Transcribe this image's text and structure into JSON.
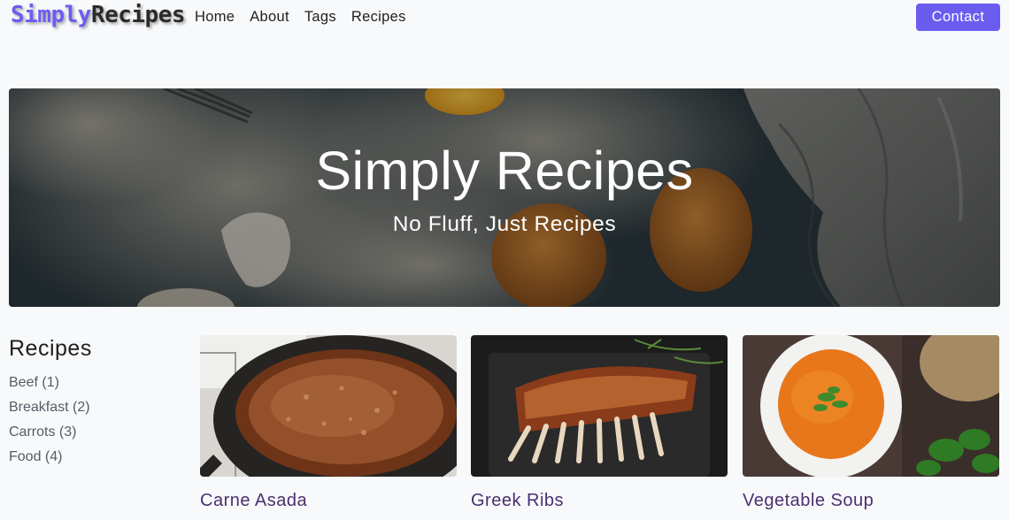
{
  "brand": {
    "part1": "Simply",
    "part2": "Recipes"
  },
  "nav": {
    "links": [
      "Home",
      "About",
      "Tags",
      "Recipes"
    ],
    "contact": "Contact"
  },
  "hero": {
    "title": "Simply Recipes",
    "subtitle": "No Fluff, Just Recipes"
  },
  "sidebar": {
    "title": "Recipes",
    "items": [
      "Beef (1)",
      "Breakfast (2)",
      "Carrots (3)",
      "Food (4)"
    ]
  },
  "recipes": [
    {
      "title": "Carne Asada",
      "image": "carne-asada-photo"
    },
    {
      "title": "Greek Ribs",
      "image": "greek-ribs-photo"
    },
    {
      "title": "Vegetable Soup",
      "image": "vegetable-soup-photo"
    }
  ],
  "colors": {
    "accent": "#6b5cf0",
    "card_title": "#4a2f6e",
    "page_bg": "#f8f9fb"
  }
}
